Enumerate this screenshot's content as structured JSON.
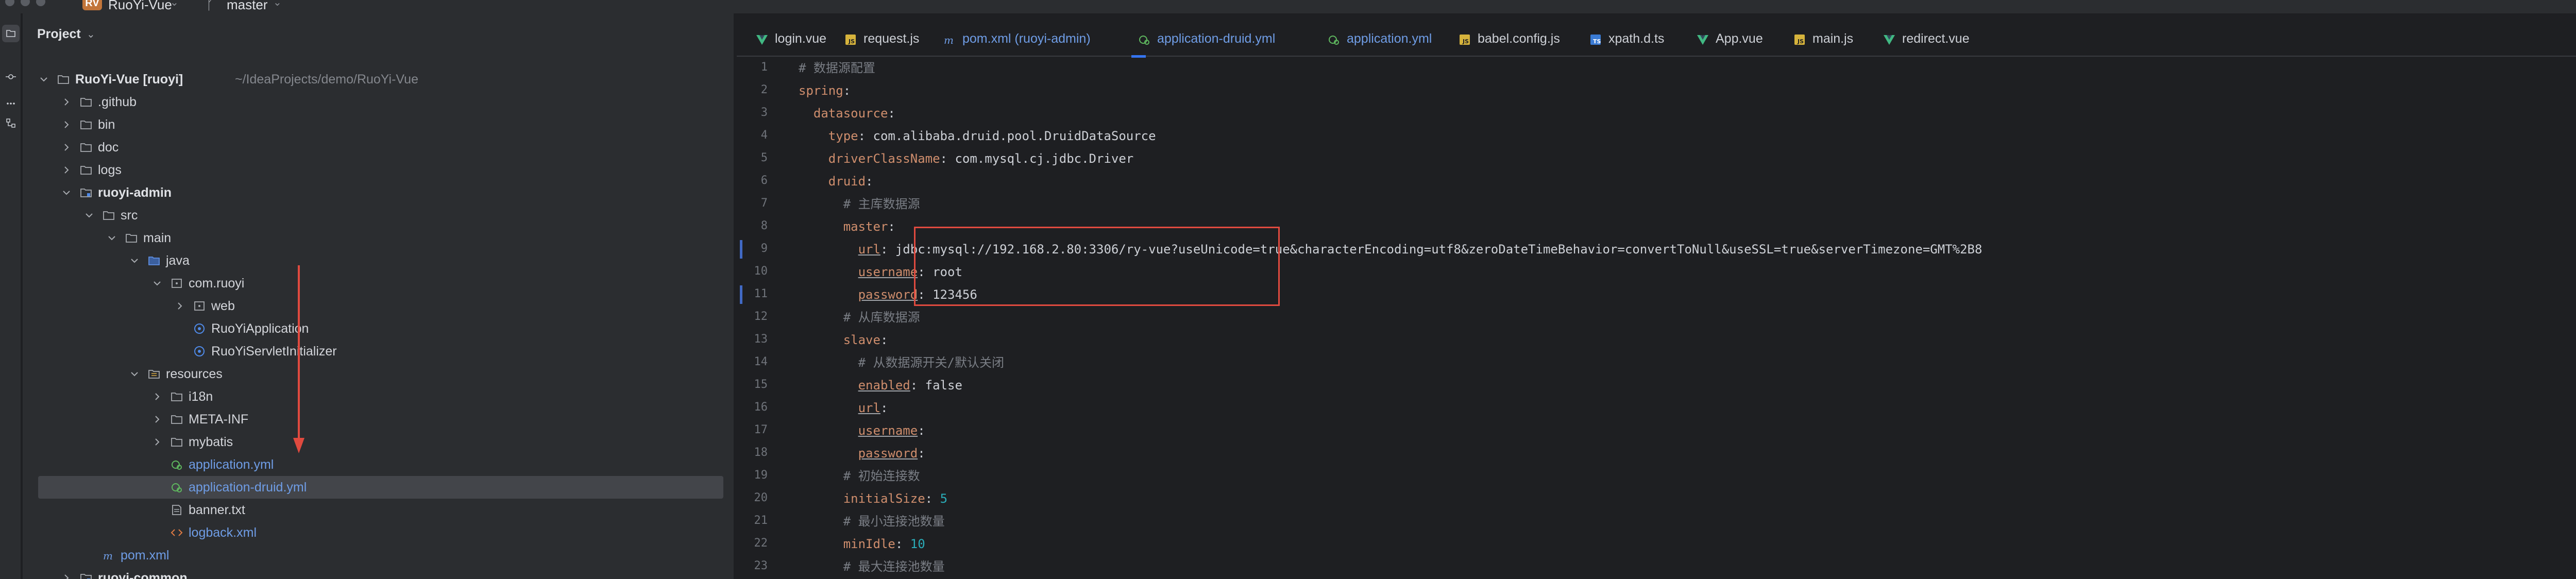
{
  "titlebar": {
    "project_badge": "RV",
    "project_name": "RuoYi-Vue",
    "branch": "master"
  },
  "toolstrip": {
    "items": [
      "folder-icon",
      "commit-icon",
      "more-icon",
      "structure-icon"
    ]
  },
  "project_panel": {
    "title": "Project",
    "tree": [
      {
        "label": "RuoYi-Vue [ruoyi]",
        "path": "~/IdeaProjects/demo/RuoYi-Vue",
        "icon": "folder-icon",
        "expanded": true
      },
      {
        "label": ".github",
        "icon": "folder-icon",
        "expanded": false
      },
      {
        "label": "bin",
        "icon": "folder-icon",
        "expanded": false
      },
      {
        "label": "doc",
        "icon": "folder-icon",
        "expanded": false
      },
      {
        "label": "logs",
        "icon": "folder-icon",
        "expanded": false
      },
      {
        "label": "ruoyi-admin",
        "icon": "module-folder-icon",
        "expanded": true
      },
      {
        "label": "src",
        "icon": "folder-icon",
        "expanded": true
      },
      {
        "label": "main",
        "icon": "folder-icon",
        "expanded": true
      },
      {
        "label": "java",
        "icon": "source-folder-icon",
        "expanded": true
      },
      {
        "label": "com.ruoyi",
        "icon": "package-icon",
        "expanded": true
      },
      {
        "label": "web",
        "icon": "package-icon",
        "expanded": false
      },
      {
        "label": "RuoYiApplication",
        "icon": "java-class-icon"
      },
      {
        "label": "RuoYiServletInitializer",
        "icon": "java-class-icon"
      },
      {
        "label": "resources",
        "icon": "resources-folder-icon",
        "expanded": true
      },
      {
        "label": "i18n",
        "icon": "folder-icon",
        "expanded": false
      },
      {
        "label": "META-INF",
        "icon": "folder-icon",
        "expanded": false
      },
      {
        "label": "mybatis",
        "icon": "folder-icon",
        "expanded": false
      },
      {
        "label": "application.yml",
        "icon": "yaml-icon"
      },
      {
        "label": "application-druid.yml",
        "icon": "yaml-icon",
        "selected": true
      },
      {
        "label": "banner.txt",
        "icon": "text-file-icon"
      },
      {
        "label": "logback.xml",
        "icon": "xml-icon"
      },
      {
        "label": "pom.xml",
        "icon": "maven-icon"
      },
      {
        "label": "ruoyi-common",
        "icon": "module-folder-icon",
        "expanded": false
      }
    ]
  },
  "tabs": [
    {
      "label": "login.vue",
      "icon": "vue-icon"
    },
    {
      "label": "request.js",
      "icon": "js-icon"
    },
    {
      "label": "pom.xml (ruoyi-admin)",
      "icon": "maven-icon"
    },
    {
      "label": "application-druid.yml",
      "icon": "yaml-icon",
      "active": true
    },
    {
      "label": "application.yml",
      "icon": "yaml-icon"
    },
    {
      "label": "babel.config.js",
      "icon": "js-icon"
    },
    {
      "label": "xpath.d.ts",
      "icon": "ts-icon"
    },
    {
      "label": "App.vue",
      "icon": "vue-icon"
    },
    {
      "label": "main.js",
      "icon": "js-icon"
    },
    {
      "label": "redirect.vue",
      "icon": "vue-icon"
    }
  ],
  "editor": {
    "line_numbers": [
      "1",
      "2",
      "3",
      "4",
      "5",
      "6",
      "7",
      "8",
      "9",
      "10",
      "11",
      "12",
      "13",
      "14",
      "15",
      "16",
      "17",
      "18",
      "19",
      "20",
      "21",
      "22",
      "23"
    ],
    "lines": [
      {
        "indent": "",
        "comment": "# 数据源配置"
      },
      {
        "indent": "",
        "key": "spring",
        "sep": ":"
      },
      {
        "indent": "  ",
        "key": "datasource",
        "sep": ":"
      },
      {
        "indent": "    ",
        "key": "type",
        "sep": ": ",
        "value": "com.alibaba.druid.pool.DruidDataSource"
      },
      {
        "indent": "    ",
        "key": "driverClassName",
        "sep": ": ",
        "value": "com.mysql.cj.jdbc.Driver"
      },
      {
        "indent": "    ",
        "key": "druid",
        "sep": ":"
      },
      {
        "indent": "      ",
        "comment": "# 主库数据源"
      },
      {
        "indent": "      ",
        "key": "master",
        "sep": ":"
      },
      {
        "indent": "        ",
        "key": "url",
        "sep": ": ",
        "value": "jdbc:mysql://192.168.2.80:3306/ry-vue?useUnicode=true&characterEncoding=utf8&zeroDateTimeBehavior=convertToNull&useSSL=true&serverTimezone=GMT%2B8"
      },
      {
        "indent": "        ",
        "key": "username",
        "sep": ": ",
        "value": "root"
      },
      {
        "indent": "        ",
        "key": "password",
        "sep": ": ",
        "value": "123456"
      },
      {
        "indent": "      ",
        "comment": "# 从库数据源"
      },
      {
        "indent": "      ",
        "key": "slave",
        "sep": ":"
      },
      {
        "indent": "        ",
        "comment": "# 从数据源开关/默认关闭"
      },
      {
        "indent": "        ",
        "key": "enabled",
        "sep": ": ",
        "value": "false"
      },
      {
        "indent": "        ",
        "key": "url",
        "sep": ":"
      },
      {
        "indent": "        ",
        "key": "username",
        "sep": ":"
      },
      {
        "indent": "        ",
        "key": "password",
        "sep": ":"
      },
      {
        "indent": "      ",
        "comment": "# 初始连接数"
      },
      {
        "indent": "      ",
        "key": "initialSize",
        "sep": ": ",
        "number": "5"
      },
      {
        "indent": "      ",
        "comment": "# 最小连接池数量"
      },
      {
        "indent": "      ",
        "key": "minIdle",
        "sep": ": ",
        "number": "10"
      },
      {
        "indent": "      ",
        "comment": "# 最大连接池数量"
      }
    ]
  },
  "colors": {
    "panel_bg": "#2b2d30",
    "editor_bg": "#1e1f22",
    "yaml_key": "#cf8e6d",
    "comment": "#7a7e85",
    "number": "#2aacb8",
    "highlight_box": "#e04a3f",
    "annotation_arrow": "#e04a3f"
  }
}
